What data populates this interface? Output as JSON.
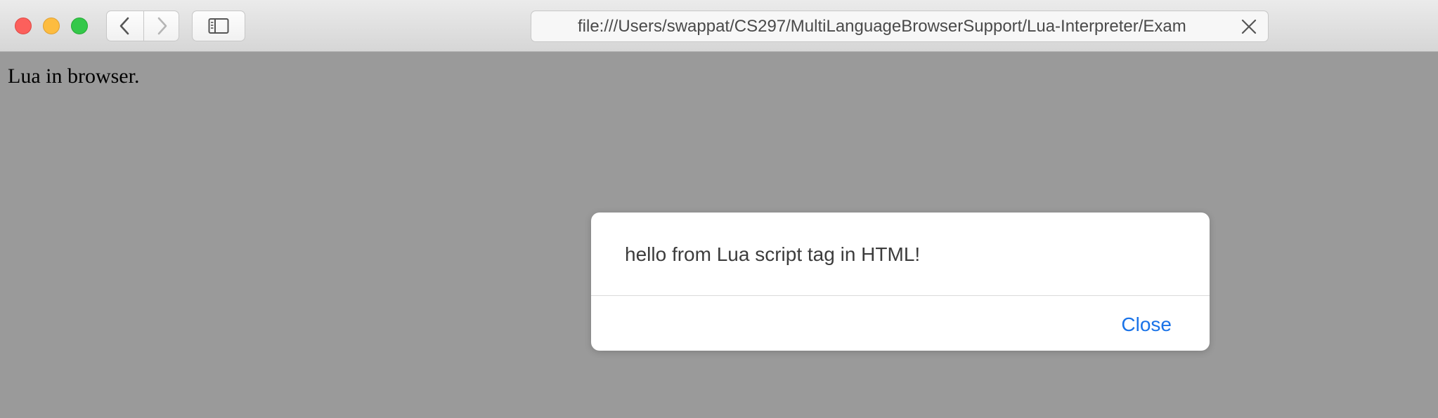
{
  "browser": {
    "address": "file:///Users/swappat/CS297/MultiLanguageBrowserSupport/Lua-Interpreter/Exam",
    "icons": {
      "close_window": "traffic-close-icon",
      "minimize_window": "traffic-minimize-icon",
      "maximize_window": "traffic-maximize-icon",
      "back": "chevron-left-icon",
      "forward": "chevron-right-icon",
      "sidebar": "sidebar-icon",
      "stop": "close-icon"
    },
    "colors": {
      "traffic_close": "#fc605c",
      "traffic_minimize": "#fdbc40",
      "traffic_maximize": "#34c84a"
    }
  },
  "page": {
    "body_text": "Lua in browser.",
    "background": "#9a9a9a"
  },
  "dialog": {
    "message": "hello from Lua script tag in HTML!",
    "close_label": "Close",
    "accent": "#1a73e8"
  }
}
